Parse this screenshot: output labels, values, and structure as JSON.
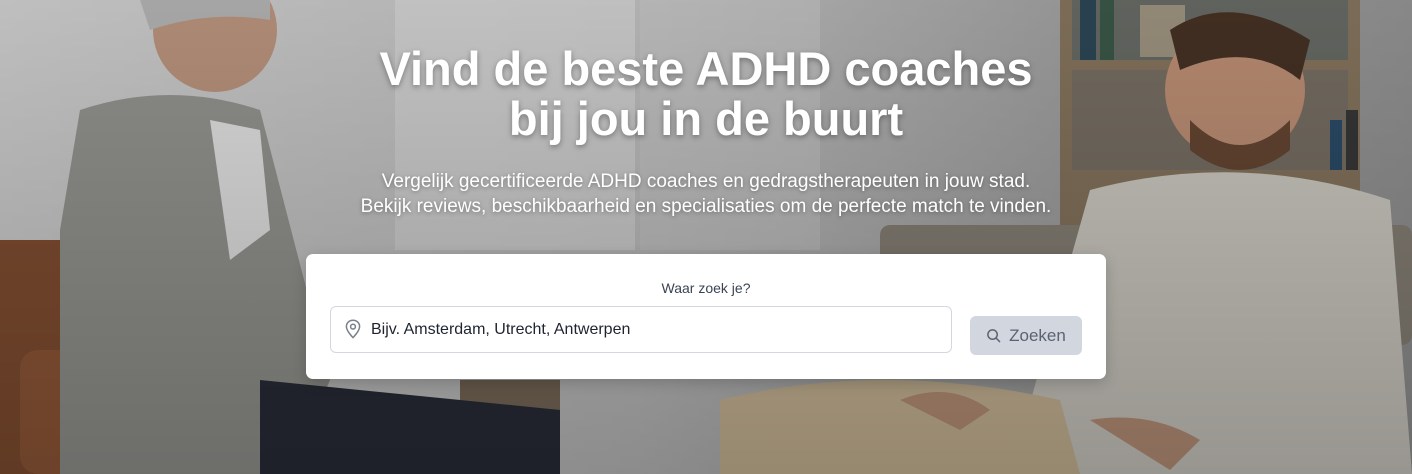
{
  "hero": {
    "headline_line1": "Vind de beste ADHD coaches",
    "headline_line2": "bij jou in de buurt",
    "subtitle_line1": "Vergelijk gecertificeerde ADHD coaches en gedragstherapeuten in jouw stad.",
    "subtitle_line2": "Bekijk reviews, beschikbaarheid en specialisaties om de perfecte match te vinden."
  },
  "search": {
    "label": "Waar zoek je?",
    "placeholder": "Bijv. Amsterdam, Utrecht, Antwerpen",
    "value": "",
    "button_label": "Zoeken",
    "location_icon": "map-pin-icon",
    "button_icon": "search-icon"
  },
  "colors": {
    "button_bg": "#d2d6de",
    "button_text": "#5b6272",
    "card_bg": "#ffffff",
    "headline": "#ffffff"
  }
}
